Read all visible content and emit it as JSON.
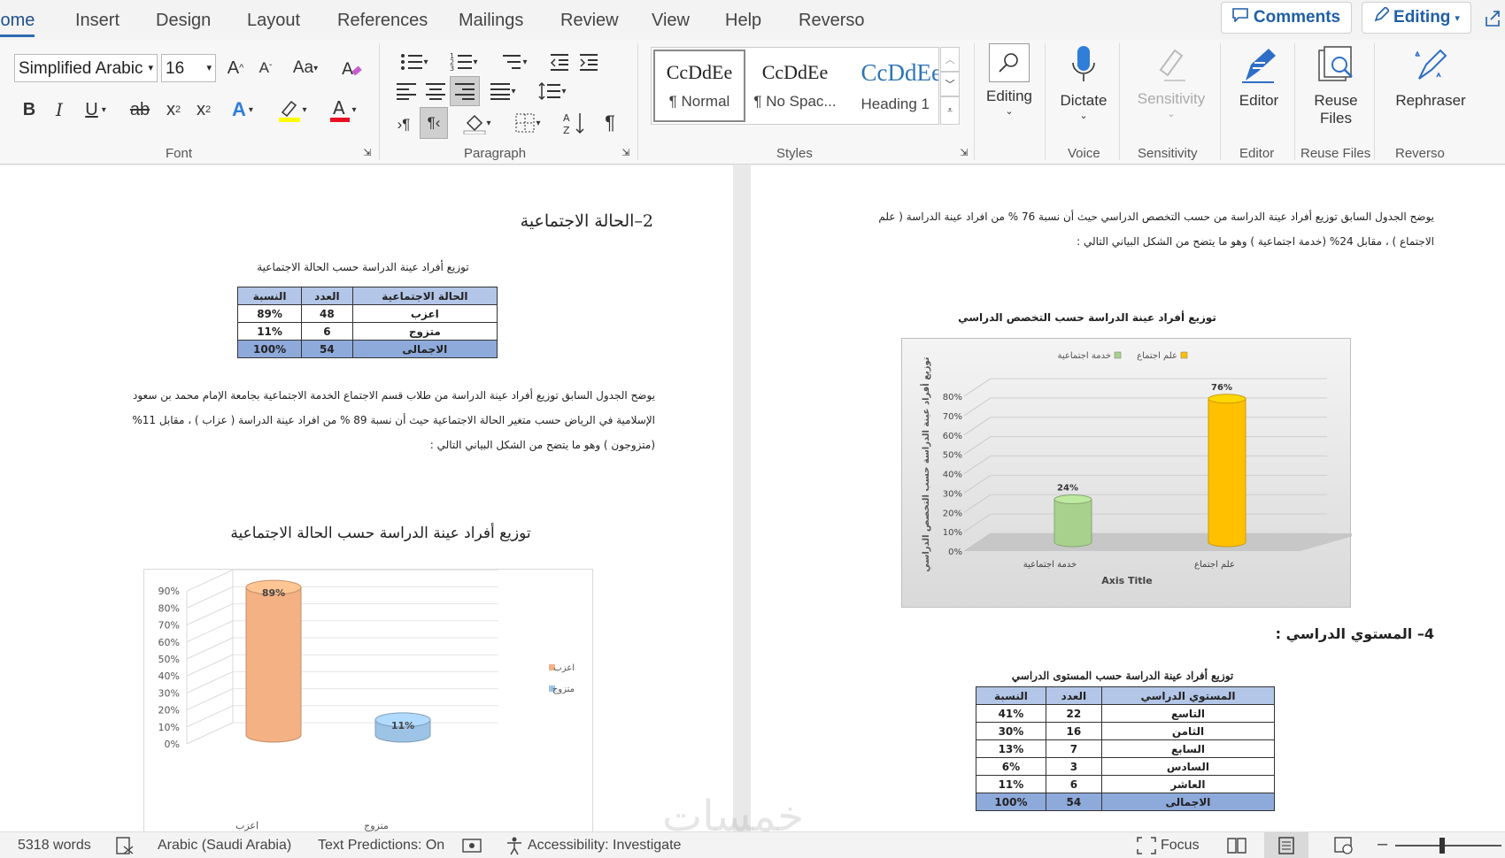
{
  "tabs": [
    "Home",
    "Insert",
    "Design",
    "Layout",
    "References",
    "Mailings",
    "Review",
    "View",
    "Help",
    "Reverso"
  ],
  "top_right": {
    "comments": "Comments",
    "editing": "Editing"
  },
  "font": {
    "name": "Simplified Arabic",
    "size": "16",
    "group_label": "Font"
  },
  "paragraph": {
    "group_label": "Paragraph"
  },
  "styles": {
    "group_label": "Styles",
    "items": [
      {
        "preview": "CcDdEe",
        "name": "¶ Normal"
      },
      {
        "preview": "CcDdEe",
        "name": "¶ No Spac..."
      },
      {
        "preview": "CcDdEe",
        "name": "Heading 1"
      }
    ]
  },
  "groups": {
    "editing": "Editing",
    "dictate": "Dictate",
    "voice": "Voice",
    "sensitivity_btn": "Sensitivity",
    "sensitivity": "Sensitivity",
    "editor_btn": "Editor",
    "editor": "Editor",
    "reuse_btn_1": "Reuse",
    "reuse_btn_2": "Files",
    "reuse": "Reuse Files",
    "rephraser": "Rephraser",
    "reverso": "Reverso"
  },
  "left_page": {
    "heading": "2–الحالة الاجتماعية",
    "table_caption": "توزيع أفراد عينة الدراسة حسب الحالة الاجتماعية",
    "table": {
      "headers": [
        "الحالة الاجتماعية",
        "العدد",
        "النسبة"
      ],
      "rows": [
        [
          "اعزب",
          "48",
          "89%"
        ],
        [
          "متزوج",
          "6",
          "11%"
        ]
      ],
      "total": [
        "الاجمالى",
        "54",
        "100%"
      ]
    },
    "para": [
      "يوضح الجدول السابق توزيع أفراد عينة الدراسة من طلاب  قسم الاجتماع الخدمة الاجتماعية  بجامعة الإمام محمد بن سعود",
      "الإسلامية في الرياض  حسب متغير الحالة الاجتماعية حيث أن نسبة 89 % من افراد عينة الدراسة ( عزاب ) ، مقابل 11%",
      "(متزوجون ) وهو ما يتضح من الشكل البياني التالي :"
    ]
  },
  "right_page": {
    "para": [
      "يوضح الجدول السابق توزيع أفراد عينة الدراسة من حسب التخصص الدراسي حيث أن نسبة 76 % من افراد عينة الدراسة ( علم",
      "الاجتماع ) ، مقابل 24%  (خدمة اجتماعية ) وهو ما يتضح من الشكل البياني التالي :"
    ],
    "heading": "4– المستوي الدراسي :",
    "table_caption": "توزيع أفراد عينة الدراسة حسب المستوى الدراسي",
    "table": {
      "headers": [
        "المستوي الدراسي",
        "العدد",
        "النسبة"
      ],
      "rows": [
        [
          "التاسع",
          "22",
          "41%"
        ],
        [
          "الثامن",
          "16",
          "30%"
        ],
        [
          "السابع",
          "7",
          "13%"
        ],
        [
          "السادس",
          "3",
          "6%"
        ],
        [
          "العاشر",
          "6",
          "11%"
        ]
      ],
      "total": [
        "الاجمالى",
        "54",
        "100%"
      ]
    }
  },
  "chart_data": [
    {
      "type": "bar",
      "title": "توزيع أفراد عينة الدراسة حسب الحالة الاجتماعية",
      "categories": [
        "اعزب",
        "متزوج"
      ],
      "series": [
        {
          "name": "اعزب",
          "values": [
            0.89,
            null
          ],
          "color": "#f4b183"
        },
        {
          "name": "متزوج",
          "values": [
            null,
            0.11
          ],
          "color": "#9dc3e6"
        }
      ],
      "data_labels": [
        "89%",
        "11%"
      ],
      "yticks": [
        "0%",
        "10%",
        "20%",
        "30%",
        "40%",
        "50%",
        "60%",
        "70%",
        "80%",
        "90%"
      ],
      "ylim": [
        0,
        0.9
      ],
      "legend": "right",
      "style": "3d-cylinder"
    },
    {
      "type": "bar",
      "title": "توزيع أفراد عينة الدراسة حسب التخصص الدراسي",
      "categories": [
        "خدمة اجتماعية",
        "علم اجتماع"
      ],
      "series": [
        {
          "name": "خدمة اجتماعية",
          "values": [
            0.24,
            null
          ],
          "color": "#a9d18e"
        },
        {
          "name": "علم اجتماع",
          "values": [
            null,
            0.76
          ],
          "color": "#ffc000"
        }
      ],
      "data_labels": [
        "24%",
        "76%"
      ],
      "yticks": [
        "0%",
        "10%",
        "20%",
        "30%",
        "40%",
        "50%",
        "60%",
        "70%",
        "80%"
      ],
      "ylim": [
        0,
        0.8
      ],
      "xlabel": "Axis Title",
      "ylabel": "توزيع أفراد عينة الدراسة حسب التخصص الدراسي",
      "legend": "top",
      "style": "3d-cylinder"
    }
  ],
  "status": {
    "words": "5318 words",
    "language": "Arabic (Saudi Arabia)",
    "predictions": "Text Predictions: On",
    "accessibility": "Accessibility: Investigate",
    "focus": "Focus"
  },
  "watermark": "خمسات"
}
